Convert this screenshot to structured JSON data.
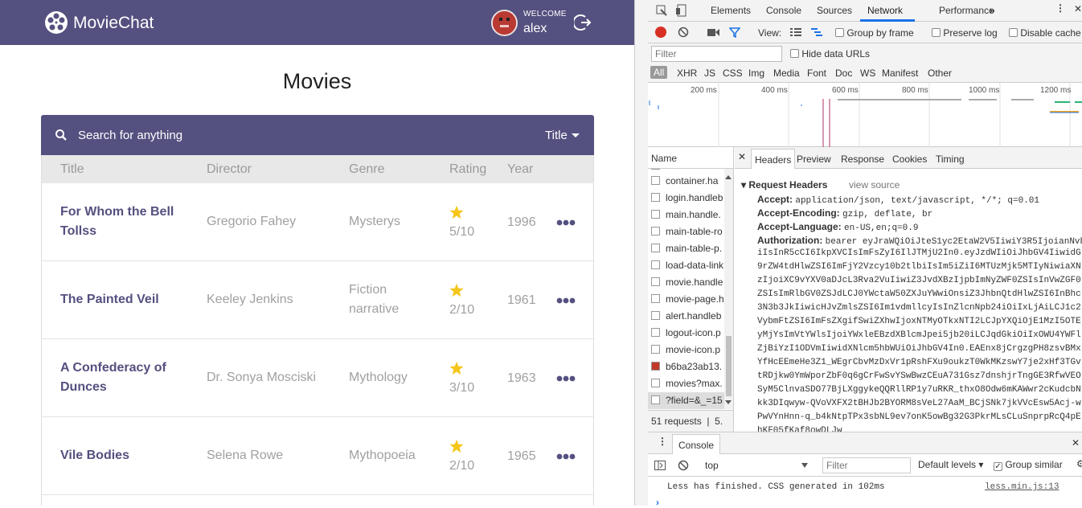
{
  "app": {
    "brand": "MovieChat",
    "welcome": "WELCOME",
    "username": "alex",
    "page_title": "Movies",
    "search_placeholder": "Search for anything",
    "filter_field": "Title",
    "columns": [
      "Title",
      "Director",
      "Genre",
      "Rating",
      "Year"
    ],
    "movies": [
      {
        "title": "For Whom the Bell Tollss",
        "director": "Gregorio Fahey",
        "genre": "Mysterys",
        "rating": "5/10",
        "year": "1996"
      },
      {
        "title": "The Painted Veil",
        "director": "Keeley Jenkins",
        "genre": "Fiction narrative",
        "rating": "2/10",
        "year": "1961"
      },
      {
        "title": "A Confederacy of Dunces",
        "director": "Dr. Sonya Mosciski",
        "genre": "Mythology",
        "rating": "3/10",
        "year": "1963"
      },
      {
        "title": "Vile Bodies",
        "director": "Selena Rowe",
        "genre": "Mythopoeia",
        "rating": "2/10",
        "year": "1965"
      }
    ]
  },
  "devtools": {
    "tabs": [
      "Elements",
      "Console",
      "Sources",
      "Network",
      "Performance"
    ],
    "active_tab": "Network",
    "toolbar": {
      "view": "View:",
      "group_by_frame": "Group by frame",
      "preserve_log": "Preserve log",
      "disable_cache": "Disable cache"
    },
    "filter_placeholder": "Filter",
    "hide_data_urls": "Hide data URLs",
    "types": [
      "All",
      "XHR",
      "JS",
      "CSS",
      "Img",
      "Media",
      "Font",
      "Doc",
      "WS",
      "Manifest",
      "Other"
    ],
    "timeline_ticks": [
      "200 ms",
      "400 ms",
      "600 ms",
      "800 ms",
      "1000 ms",
      "1200 ms"
    ],
    "name_header": "Name",
    "files": [
      "container.ha",
      "login.handleb",
      "main.handle.",
      "main-table-ro",
      "main-table-p.",
      "load-data-link",
      "movie.handle",
      "movie-page.h",
      "alert.handleb",
      "logout-icon.p",
      "movie-icon.p",
      "b6ba23ab13.",
      "movies?max.",
      "?field=&_=15"
    ],
    "requests_summary": "51 requests",
    "requests_summary_tail": "5.",
    "detail_tabs": [
      "Headers",
      "Preview",
      "Response",
      "Cookies",
      "Timing"
    ],
    "request_headers_title": "Request Headers",
    "view_source": "view source",
    "headers": [
      {
        "k": "Accept:",
        "v": "application/json, text/javascript, */*; q=0.01"
      },
      {
        "k": "Accept-Encoding:",
        "v": "gzip, deflate, br"
      },
      {
        "k": "Accept-Language:",
        "v": "en-US,en;q=0.9"
      },
      {
        "k": "Authorization:",
        "v": "bearer eyJraWQiOiJteS1yc2EtaW2V5IiwiY3R5IjoianNvb"
      }
    ],
    "auth_lines": [
      "iIsInR5cCI6IkpXVCIsImFsZyI6IlJTMjU2In0.eyJzdWIiOiJhbGV4IiwidG",
      "9rZW4tdHlwZSI6ImFjY2Vzcy10b2tlbiIsIm5iZiI6MTUzMjk5MTIyNiwiaXN",
      "zIjoiXC9vYXV0aDJcL3Rva2VuIiwiZ3JvdXBzIjpbImNyZWF0ZSIsInVwZGF0",
      "ZSIsImRlbGV0ZSJdLCJ0YWctaW50ZXJuYWwiOnsiZ3JhbnQtdHlwZSI6InBhc",
      "3N3b3JkIiwicHJvZmlsZSI6Im1vdmllcyIsInZlcnNpb24iOiIxLjAiLCJ1c2",
      "VybmFtZSI6ImFsZXgifSwiZXhwIjoxNTMyOTkxNTI2LCJpYXQiOjE1MzI5OTE",
      "yMjYsImVtYWlsIjoiYWxleEBzdXBlcmJpei5jb20iLCJqdGkiOiIxOWU4YWFl",
      "ZjBiYzI1ODVmIiwidXNlcm5hbWUiOiJhbGV4In0.EAEnx8jCrgzgPH8zsvBMx",
      "YfHcEEmeHe3Z1_WEgrCbvMzDxVr1pRshFXu9oukzT0WkMKzswY7je2xHf3TGv",
      "tRDjkw0YmWporZbF0q6gCrFwSvYSwBwzCEuA731Gsz7dnshjrTngGE3RfwVEO",
      "SyM5ClnvaSDO77BjLXggykeQQRllRP1y7uRKR_thxO8Odw6mKAWwr2cKudcbN",
      "kk3DIqwyw-QVoVXFX2tBHJb2BYORM8sVeL27AaM_BCjSNk7jkVVcEsw5Acj-w",
      "PwVYnHnn-q_b4kNtpTPx3sbNL9ev7onK5owBg32G3PkrMLsCLuSnprpRcQ4pE",
      "hKF05fKaf8owDLJw"
    ],
    "console_tab": "Console",
    "context": "top",
    "console_filter": "Filter",
    "default_levels": "Default levels",
    "group_similar": "Group similar",
    "console_msg": "Less has finished. CSS generated in 102ms",
    "console_src": "less.min.js:13"
  }
}
